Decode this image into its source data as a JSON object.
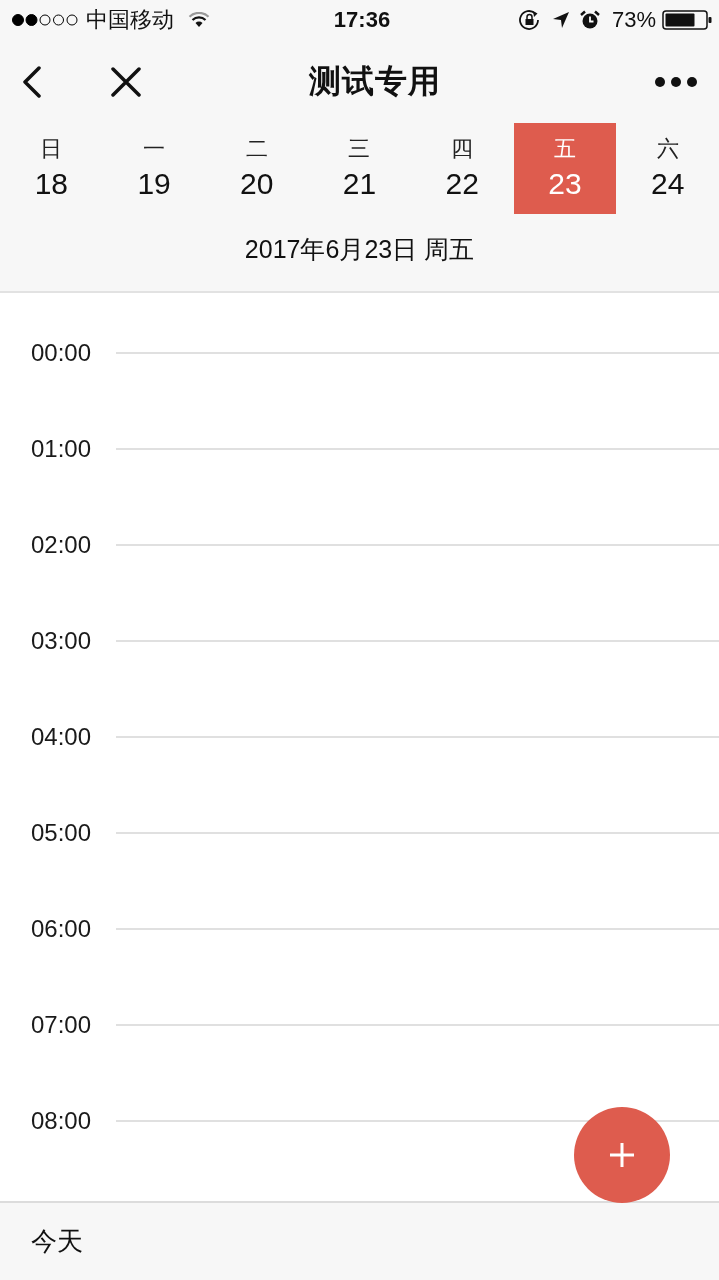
{
  "status_bar": {
    "carrier": "中国移动",
    "time": "17:36",
    "battery": "73%"
  },
  "nav_bar": {
    "title": "测试专用"
  },
  "week": {
    "days": [
      {
        "weekday": "日",
        "date": "18",
        "selected": false
      },
      {
        "weekday": "一",
        "date": "19",
        "selected": false
      },
      {
        "weekday": "二",
        "date": "20",
        "selected": false
      },
      {
        "weekday": "三",
        "date": "21",
        "selected": false
      },
      {
        "weekday": "四",
        "date": "22",
        "selected": false
      },
      {
        "weekday": "五",
        "date": "23",
        "selected": true
      },
      {
        "weekday": "六",
        "date": "24",
        "selected": false
      }
    ]
  },
  "selected_date": "2017年6月23日 周五",
  "timeline": {
    "hours": [
      "00:00",
      "01:00",
      "02:00",
      "03:00",
      "04:00",
      "05:00",
      "06:00",
      "07:00",
      "08:00"
    ]
  },
  "bottom_bar": {
    "today_button": "今天"
  }
}
